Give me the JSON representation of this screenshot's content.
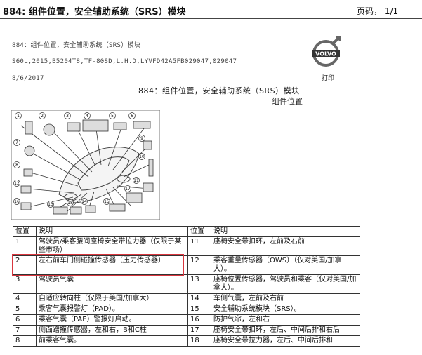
{
  "header": {
    "title": "884: 组件位置，安全辅助系统（SRS）模块",
    "page_label": "页码， 1/1"
  },
  "doc": {
    "subtitle": "884：组件位置，安全辅助系统（SRS）模块",
    "vehicle": "S60L,2015,B5204T8,TF-80SD,L.H.D,LYVFD42A5FB029047,029047",
    "date": "8/6/2017",
    "center_title": "884：组件位置，安全辅助系统（SRS）模块",
    "component_positions": "组件位置",
    "print_label": "打印",
    "logo_text": "VOLVO"
  },
  "diagram_labels": [
    "1",
    "2",
    "3",
    "4",
    "5",
    "6",
    "7",
    "8",
    "9",
    "10",
    "11",
    "12",
    "13",
    "14",
    "15",
    "16",
    "17",
    "18"
  ],
  "table": {
    "headers": [
      "位置",
      "说明",
      "位置",
      "说明"
    ],
    "rows": [
      [
        "1",
        "驾驶员/乘客腰间座椅安全带拉力器（仅限于某些市场）",
        "11",
        "座椅安全带扣环，左前及右前"
      ],
      [
        "2",
        "左右前车门侧碰撞传感器（压力传感器）",
        "12",
        "乘客重量传感器（OWS）（仅对美国/加拿大）。"
      ],
      [
        "3",
        "驾驶员气囊",
        "13",
        "座椅位置传感器，驾驶员和乘客（仅对美国/加拿大）。"
      ],
      [
        "4",
        "自适应转向柱（仅限于美国/加拿大）",
        "14",
        "车侧气囊，左前及右前"
      ],
      [
        "5",
        "乘客气囊报警灯（PAD）。",
        "15",
        "安全辅助系统模块（SRS）。"
      ],
      [
        "6",
        "乘客气囊（PAE）警报灯启动。",
        "16",
        "防护气帘，左和右"
      ],
      [
        "7",
        "侧面蹭撞传感器，左和右，B和C柱",
        "17",
        "座椅安全带扣环，左后、中间后排和右后"
      ],
      [
        "8",
        "前乘客气囊。",
        "18",
        "座椅安全带拉力器，左后、中间后排和"
      ]
    ]
  },
  "colors": {
    "highlight": "#d9363e"
  }
}
